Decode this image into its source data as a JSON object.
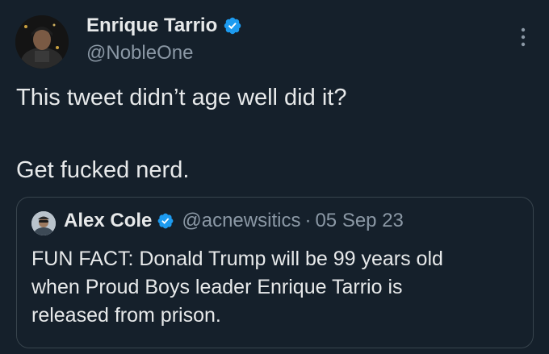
{
  "author": {
    "display_name": "Enrique Tarrio",
    "handle": "@NobleOne",
    "verified": true
  },
  "tweet": {
    "line1": "This tweet didn’t age well did it?",
    "line2": "Get fucked nerd."
  },
  "quoted_tweet": {
    "display_name": "Alex Cole",
    "handle": "@acnewsitics",
    "separator": "·",
    "date": "05 Sep 23",
    "verified": true,
    "text": "FUN FACT: Donald Trump will be 99 years old\nwhen Proud Boys leader Enrique Tarrio is\nreleased from prison."
  },
  "colors": {
    "background": "#15202b",
    "text": "#e7e9ea",
    "secondary_text": "#8b98a5",
    "verified_badge": "#1d9bf0",
    "quote_border": "#38444d"
  },
  "icons": {
    "verified": "verified-badge-icon",
    "more": "more-vertical-icon"
  }
}
